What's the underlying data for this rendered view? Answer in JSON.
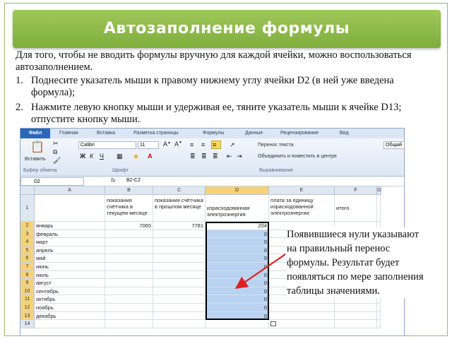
{
  "slide": {
    "title": "Автозаполнение формулы",
    "intro": "Для того, чтобы не вводить формулы вручную для каждой ячейки, можно воспользоваться автозаполнением.",
    "steps": [
      {
        "num": "1.",
        "text": "Поднесите указатель мыши к правому нижнему углу ячейки D2 (в ней уже введена формула);"
      },
      {
        "num": "2.",
        "text": "Нажмите левую кнопку мыши и удерживая ее, тяните указатель мыши к ячейке D13; отпустите кнопку мыши."
      }
    ],
    "note": "Появившиеся нули указывают на правильный перенос формулы. Результат будет появляться по мере заполнения таблицы значениями."
  },
  "excel": {
    "file_tab": "Файл",
    "tabs": [
      "Главная",
      "Вставка",
      "Разметка страницы",
      "Формулы",
      "Данные",
      "Рецензирование",
      "Вид"
    ],
    "ribbon": {
      "paste": "Вставить",
      "font_name": "Calibri",
      "font_size": "11",
      "wrap_text": "Перенос текста",
      "merge_center": "Объединить и поместить в центре",
      "number_format": "Общий",
      "group_clipboard": "Буфер обмена",
      "group_font": "Шрифт",
      "group_alignment": "Выравнивание"
    },
    "namebox": "D2",
    "fx": "fx",
    "formula": "B2-C2",
    "columns": [
      "A",
      "B",
      "C",
      "D",
      "E",
      "F",
      "G"
    ],
    "headers": {
      "b": "показания счётчика в текущем месяце",
      "c": "показания счётчика в прошлом месяце",
      "d": "израсходованная электроэнергия",
      "e": "плата за единицу израсходованной электроэнергии",
      "f": "итого"
    },
    "rows": [
      {
        "n": "1"
      },
      {
        "n": "2",
        "a": "январь",
        "b": "7065",
        "c": "7781",
        "d": "204"
      },
      {
        "n": "3",
        "a": "февраль",
        "d": "0"
      },
      {
        "n": "4",
        "a": "март",
        "d": "0"
      },
      {
        "n": "5",
        "a": "апрель",
        "d": "0"
      },
      {
        "n": "6",
        "a": "май",
        "d": "0"
      },
      {
        "n": "7",
        "a": "июнь",
        "d": "0"
      },
      {
        "n": "8",
        "a": "июль",
        "d": "0"
      },
      {
        "n": "9",
        "a": "август",
        "d": "0"
      },
      {
        "n": "10",
        "a": "сентябрь",
        "d": "0"
      },
      {
        "n": "11",
        "a": "октябрь",
        "d": "0"
      },
      {
        "n": "12",
        "a": "ноябрь",
        "d": "0"
      },
      {
        "n": "13",
        "a": "декабрь",
        "d": "0"
      },
      {
        "n": "14"
      }
    ]
  }
}
